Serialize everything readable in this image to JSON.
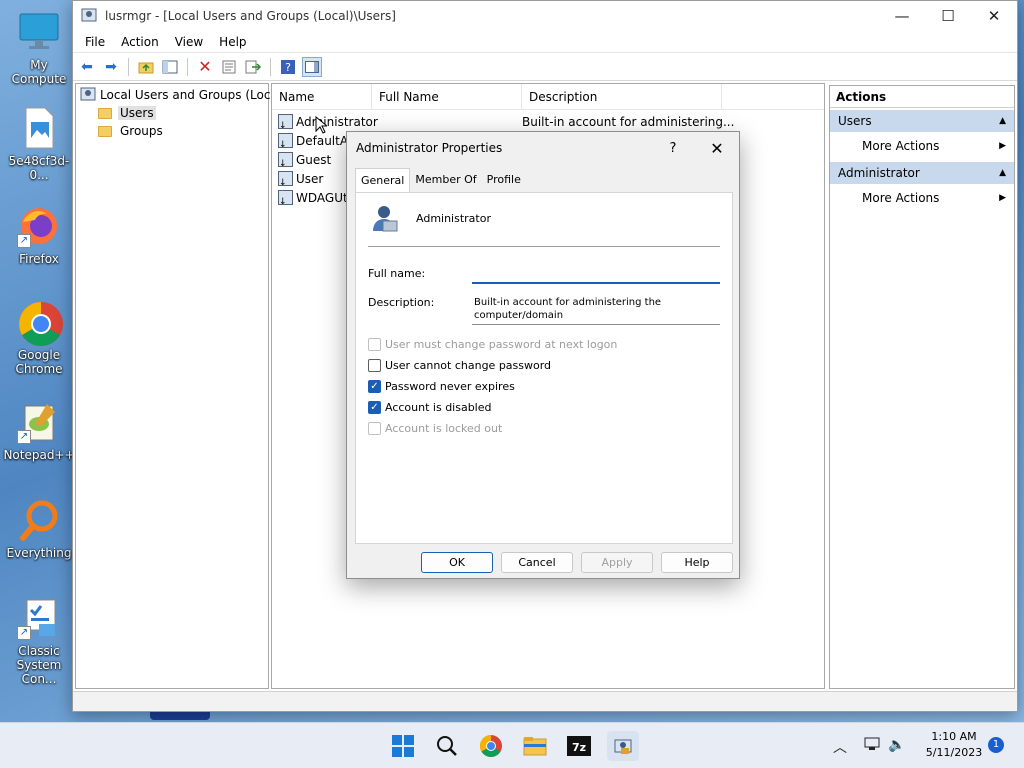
{
  "desktop": {
    "icons": [
      {
        "label": "My Compute"
      },
      {
        "label": "5e48cf3d-0..."
      },
      {
        "label": "Firefox"
      },
      {
        "label": "Google Chrome"
      },
      {
        "label": "Notepad++"
      },
      {
        "label": "Everything"
      },
      {
        "label": "Classic System Con..."
      }
    ]
  },
  "window": {
    "title": "lusrmgr - [Local Users and Groups (Local)\\Users]",
    "menu": [
      "File",
      "Action",
      "View",
      "Help"
    ]
  },
  "tree": {
    "root": "Local Users and Groups (Local)",
    "items": [
      "Users",
      "Groups"
    ]
  },
  "list": {
    "columns": [
      "Name",
      "Full Name",
      "Description"
    ],
    "rows": [
      {
        "name": "Administrator",
        "full_name": "",
        "description": "Built-in account for administering..."
      },
      {
        "name": "DefaultAc",
        "full_name": "",
        "description": ""
      },
      {
        "name": "Guest",
        "full_name": "",
        "description": ""
      },
      {
        "name": "User",
        "full_name": "",
        "description": ""
      },
      {
        "name": "WDAGUti",
        "full_name": "",
        "description": ""
      }
    ]
  },
  "actions": {
    "title": "Actions",
    "sections": [
      {
        "header": "Users",
        "item": "More Actions"
      },
      {
        "header": "Administrator",
        "item": "More Actions"
      }
    ]
  },
  "dialog": {
    "title": "Administrator Properties",
    "help_glyph": "?",
    "close_glyph": "✕",
    "tabs": [
      "General",
      "Member Of",
      "Profile"
    ],
    "active_tab": "General",
    "username": "Administrator",
    "full_name_label": "Full name:",
    "full_name_value": "",
    "description_label": "Description:",
    "description_value": "Built-in account for administering the computer/domain",
    "checkboxes": [
      {
        "label": "User must change password at next logon",
        "checked": false,
        "enabled": false
      },
      {
        "label": "User cannot change password",
        "checked": false,
        "enabled": true
      },
      {
        "label": "Password never expires",
        "checked": true,
        "enabled": true
      },
      {
        "label": "Account is disabled",
        "checked": true,
        "enabled": true
      },
      {
        "label": "Account is locked out",
        "checked": false,
        "enabled": false
      }
    ],
    "buttons": {
      "ok": "OK",
      "cancel": "Cancel",
      "apply": "Apply",
      "help": "Help"
    }
  },
  "taskbar": {
    "time": "1:10 AM",
    "date": "5/11/2023",
    "notification_count": "1",
    "pinned_icons": [
      "windows-start-icon",
      "search-icon",
      "chrome-icon",
      "file-explorer-icon",
      "7zip-icon",
      "lusrmgr-icon"
    ]
  }
}
